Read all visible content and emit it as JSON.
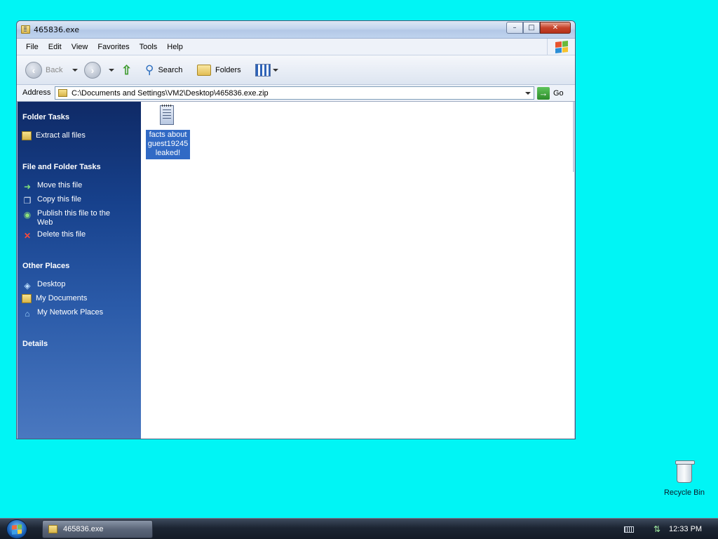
{
  "window": {
    "title": "465836.exe",
    "caption": {
      "minimize": "–",
      "maximize": "□",
      "close": "✕"
    }
  },
  "menu": [
    "File",
    "Edit",
    "View",
    "Favorites",
    "Tools",
    "Help"
  ],
  "toolbar": {
    "back_label": "Back",
    "search_label": "Search",
    "folders_label": "Folders"
  },
  "address": {
    "label": "Address",
    "value": "C:\\Documents and Settings\\VM2\\Desktop\\465836.exe.zip",
    "go_label": "Go"
  },
  "taskpane": {
    "folder_tasks": {
      "heading": "Folder Tasks",
      "items": [
        {
          "label": "Extract all files",
          "icon": "extract-icon"
        }
      ]
    },
    "file_folder_tasks": {
      "heading": "File and Folder Tasks",
      "items": [
        {
          "label": "Move this file",
          "icon": "move-icon"
        },
        {
          "label": "Copy this file",
          "icon": "copy-icon"
        },
        {
          "label": "Publish this file to the Web",
          "icon": "globe-icon"
        },
        {
          "label": "Delete this file",
          "icon": "delete-icon"
        }
      ]
    },
    "other_places": {
      "heading": "Other Places",
      "items": [
        {
          "label": "Desktop",
          "icon": "desktop-icon"
        },
        {
          "label": "My Documents",
          "icon": "documents-folder-icon"
        },
        {
          "label": "My Network Places",
          "icon": "network-icon"
        }
      ]
    },
    "details_heading": "Details"
  },
  "content": {
    "files": [
      {
        "name": "facts about guest19245 leaked!",
        "icon": "text-file-icon",
        "selected": true
      }
    ]
  },
  "desktop": {
    "recycle_bin_label": "Recycle Bin"
  },
  "taskbar": {
    "task_button_label": "465836.exe",
    "clock": "12:33 PM"
  },
  "colors": {
    "desktop_background": "#00f5f5",
    "selection": "#316ac5",
    "taskpane_top": "#0f2a66",
    "taskpane_bottom": "#4a78c0"
  }
}
